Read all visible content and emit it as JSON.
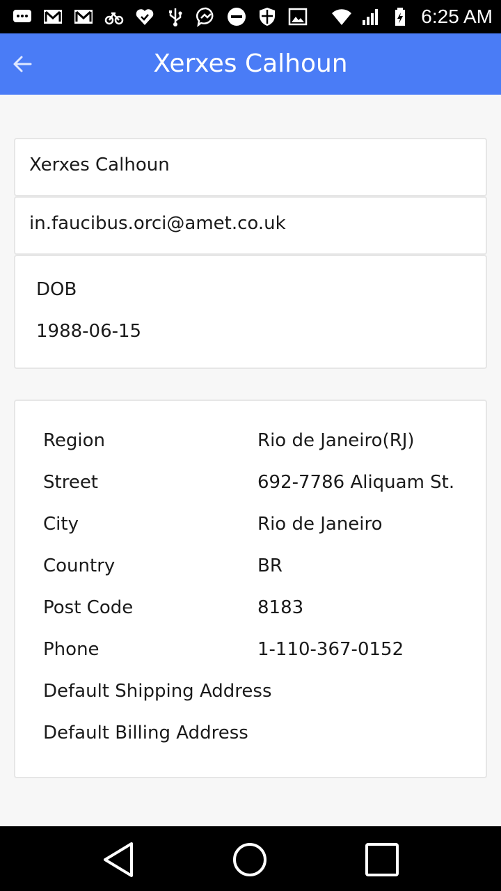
{
  "status_bar": {
    "time": "6:25 AM",
    "left_icons": [
      "message-icon",
      "gmail-icon",
      "gmail-icon",
      "bike-icon",
      "heart-check-icon",
      "usb-icon",
      "messenger-icon",
      "do-not-disturb-icon",
      "shield-icon",
      "image-icon"
    ],
    "right_icons": [
      "wifi-icon",
      "signal-icon",
      "battery-icon"
    ]
  },
  "app_bar": {
    "title": "Xerxes Calhoun",
    "back_icon": "back-arrow-icon",
    "color": "#4a7cf6"
  },
  "profile": {
    "name": "Xerxes Calhoun",
    "email": "in.faucibus.orci@amet.co.uk",
    "dob_label": "DOB",
    "dob_value": "1988-06-15"
  },
  "address": {
    "rows": [
      {
        "label": "Region",
        "value": "Rio de Janeiro(RJ)"
      },
      {
        "label": "Street",
        "value": "692-7786 Aliquam St."
      },
      {
        "label": "City",
        "value": "Rio de Janeiro"
      },
      {
        "label": "Country",
        "value": "BR"
      },
      {
        "label": "Post Code",
        "value": "8183"
      },
      {
        "label": "Phone",
        "value": "1-110-367-0152"
      }
    ],
    "default_shipping": "Default Shipping Address",
    "default_billing": "Default Billing Address"
  },
  "nav_bar": {
    "back_icon": "triangle-back-icon",
    "home_icon": "circle-home-icon",
    "recents_icon": "square-recents-icon"
  }
}
